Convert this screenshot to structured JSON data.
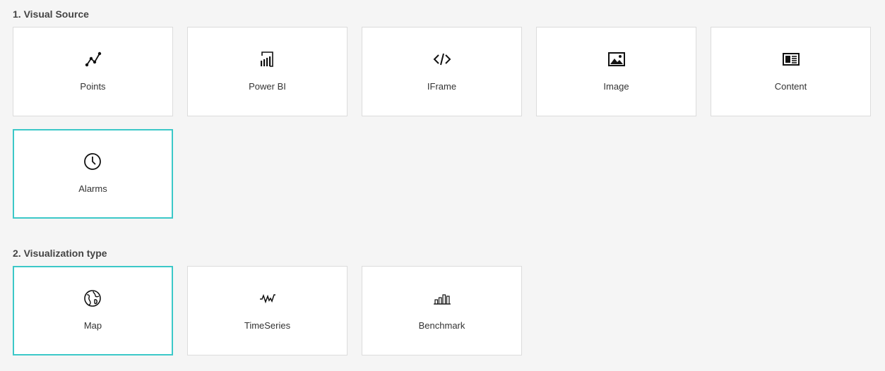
{
  "visual_source": {
    "title": "1. Visual Source",
    "cards": [
      {
        "label": "Points",
        "icon": "line-points-icon",
        "selected": false
      },
      {
        "label": "Power BI",
        "icon": "power-bi-icon",
        "selected": false
      },
      {
        "label": "IFrame",
        "icon": "code-icon",
        "selected": false
      },
      {
        "label": "Image",
        "icon": "image-icon",
        "selected": false
      },
      {
        "label": "Content",
        "icon": "content-icon",
        "selected": false
      },
      {
        "label": "Alarms",
        "icon": "clock-icon",
        "selected": true
      }
    ]
  },
  "visualization_type": {
    "title": "2. Visualization type",
    "cards": [
      {
        "label": "Map",
        "icon": "globe-icon",
        "selected": true
      },
      {
        "label": "TimeSeries",
        "icon": "pulse-icon",
        "selected": false
      },
      {
        "label": "Benchmark",
        "icon": "bar-chart-icon",
        "selected": false
      }
    ]
  },
  "colors": {
    "background": "#f5f5f5",
    "card": "#ffffff",
    "card_border": "#dcdcdc",
    "selected_border": "#3cc8c8",
    "text": "#333333"
  }
}
